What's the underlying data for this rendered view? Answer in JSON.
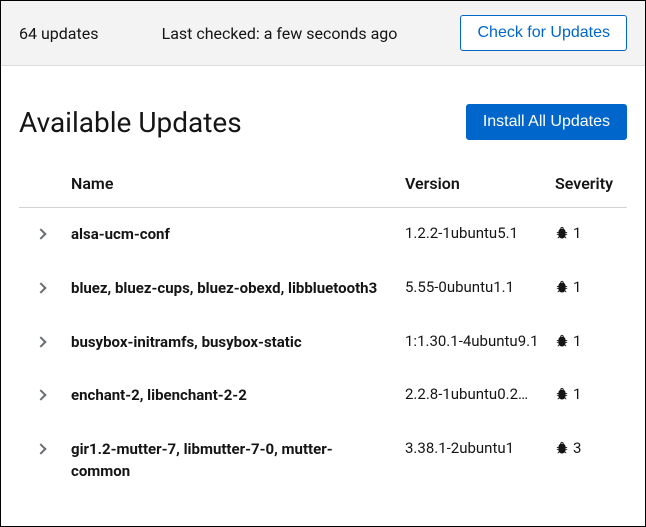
{
  "header": {
    "count_label": "64 updates",
    "last_checked_label": "Last checked: a few seconds ago",
    "check_button_label": "Check for Updates"
  },
  "main": {
    "title": "Available Updates",
    "install_button_label": "Install All Updates"
  },
  "table": {
    "columns": {
      "name": "Name",
      "version": "Version",
      "severity": "Severity"
    },
    "rows": [
      {
        "name": "alsa-ucm-conf",
        "version": "1.2.2-1ubuntu5.1",
        "severity_count": "1"
      },
      {
        "name": "bluez, bluez-cups, bluez-obexd, libbluetooth3",
        "version": "5.55-0ubuntu1.1",
        "severity_count": "1"
      },
      {
        "name": "busybox-initramfs, busybox-static",
        "version": "1:1.30.1-4ubuntu9.1",
        "severity_count": "1"
      },
      {
        "name": "enchant-2, libenchant-2-2",
        "version": "2.2.8-1ubuntu0.2…",
        "severity_count": "1"
      },
      {
        "name": "gir1.2-mutter-7, libmutter-7-0, mutter-common",
        "version": "3.38.1-2ubuntu1",
        "severity_count": "3"
      }
    ]
  }
}
